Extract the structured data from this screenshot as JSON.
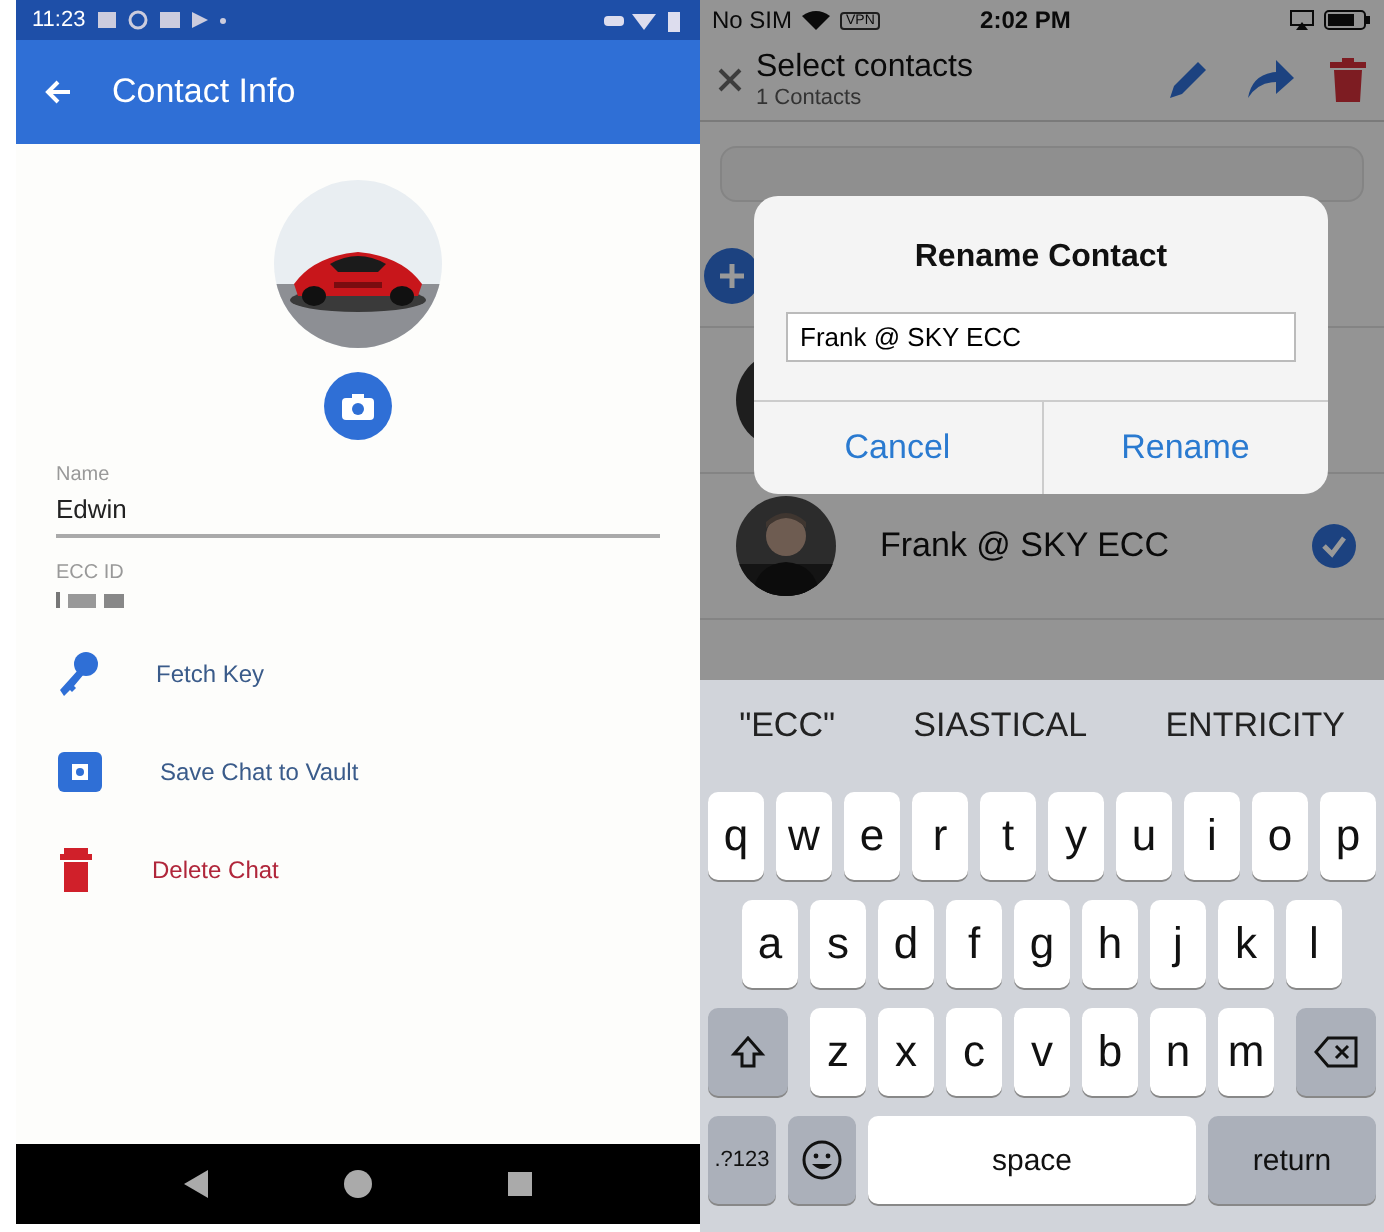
{
  "android": {
    "status_bar": {
      "time": "11:23"
    },
    "app_bar": {
      "title": "Contact Info"
    },
    "name_field": {
      "label": "Name",
      "value": "Edwin"
    },
    "ecc_id": {
      "label": "ECC ID"
    },
    "actions": [
      {
        "label": "Fetch Key",
        "kind": "key"
      },
      {
        "label": "Save Chat to Vault",
        "kind": "vault"
      },
      {
        "label": "Delete Chat",
        "kind": "delete"
      }
    ]
  },
  "ios": {
    "status_bar": {
      "carrier": "No SIM",
      "vpn": "VPN",
      "time": "2:02 PM"
    },
    "header": {
      "title": "Select contacts",
      "subtitle": "1 Contacts"
    },
    "contacts": [
      {
        "name": "Frank @ SKY ECC",
        "selected": true
      }
    ],
    "dialog": {
      "title": "Rename Contact",
      "value": "Frank @ SKY ECC",
      "buttons": [
        "Cancel",
        "Rename"
      ]
    },
    "keyboard": {
      "suggestions": [
        "\"ECC\"",
        "SIASTICAL",
        "ENTRICITY"
      ],
      "rows": [
        [
          "q",
          "w",
          "e",
          "r",
          "t",
          "y",
          "u",
          "i",
          "o",
          "p"
        ],
        [
          "a",
          "s",
          "d",
          "f",
          "g",
          "h",
          "j",
          "k",
          "l"
        ],
        [
          "z",
          "x",
          "c",
          "v",
          "b",
          "n",
          "m"
        ]
      ],
      "numbers_key": ".?123",
      "space_key": "space",
      "return_key": "return"
    }
  }
}
